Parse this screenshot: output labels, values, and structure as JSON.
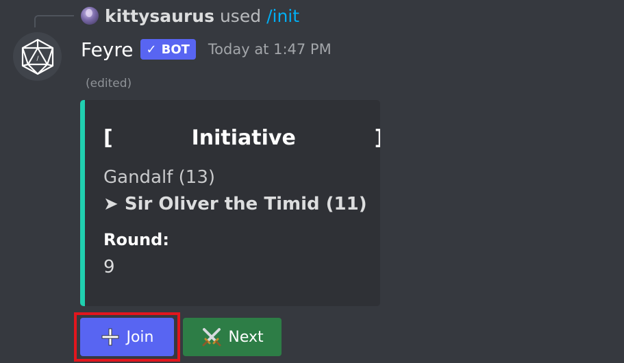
{
  "command": {
    "user": "kittysaurus",
    "used_text": "used",
    "name": "/init"
  },
  "message": {
    "author": "Feyre",
    "badge": "BOT",
    "timestamp": "Today at 1:47 PM",
    "edited": "(edited)"
  },
  "embed": {
    "accent_color": "#20d0b0",
    "title": "[           Initiative           ]",
    "entries": [
      "Gandalf (13)",
      "➤ Sir Oliver the Timid (11)"
    ],
    "field_name": "Round:",
    "field_value": "9"
  },
  "buttons": {
    "join_label": "Join",
    "join_icon": "plus-icon",
    "next_label": "Next",
    "next_icon": "crossed-swords-icon"
  },
  "colors": {
    "background": "#36393f",
    "embed_bg": "#2f3136",
    "blurple": "#5865f2",
    "green": "#2d7d46",
    "link": "#00aff4",
    "highlight": "#e2161d"
  }
}
